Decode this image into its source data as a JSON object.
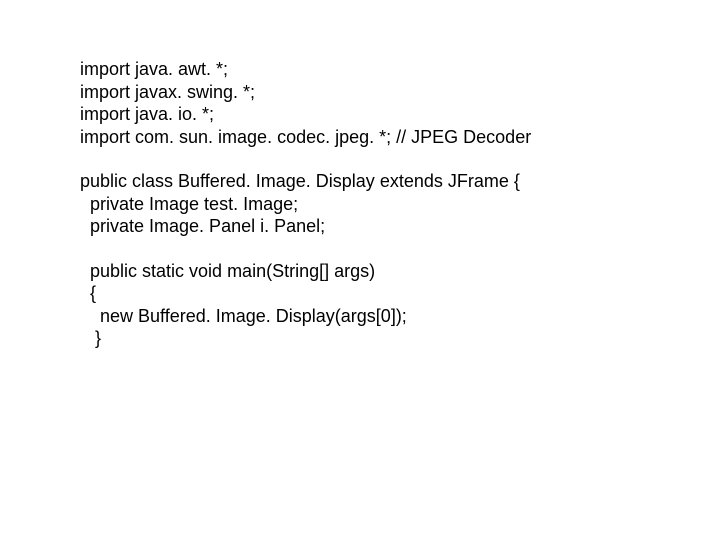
{
  "code": {
    "l1": "import java. awt. *;",
    "l2": "import javax. swing. *;",
    "l3": "import java. io. *;",
    "l4": "import com. sun. image. codec. jpeg. *; // JPEG Decoder",
    "l5": "public class Buffered. Image. Display extends JFrame {",
    "l6": "  private Image test. Image;",
    "l7": "  private Image. Panel i. Panel;",
    "l8": "  public static void main(String[] args)",
    "l9": "  {",
    "l10": "    new Buffered. Image. Display(args[0]);",
    "l11": "   }"
  }
}
